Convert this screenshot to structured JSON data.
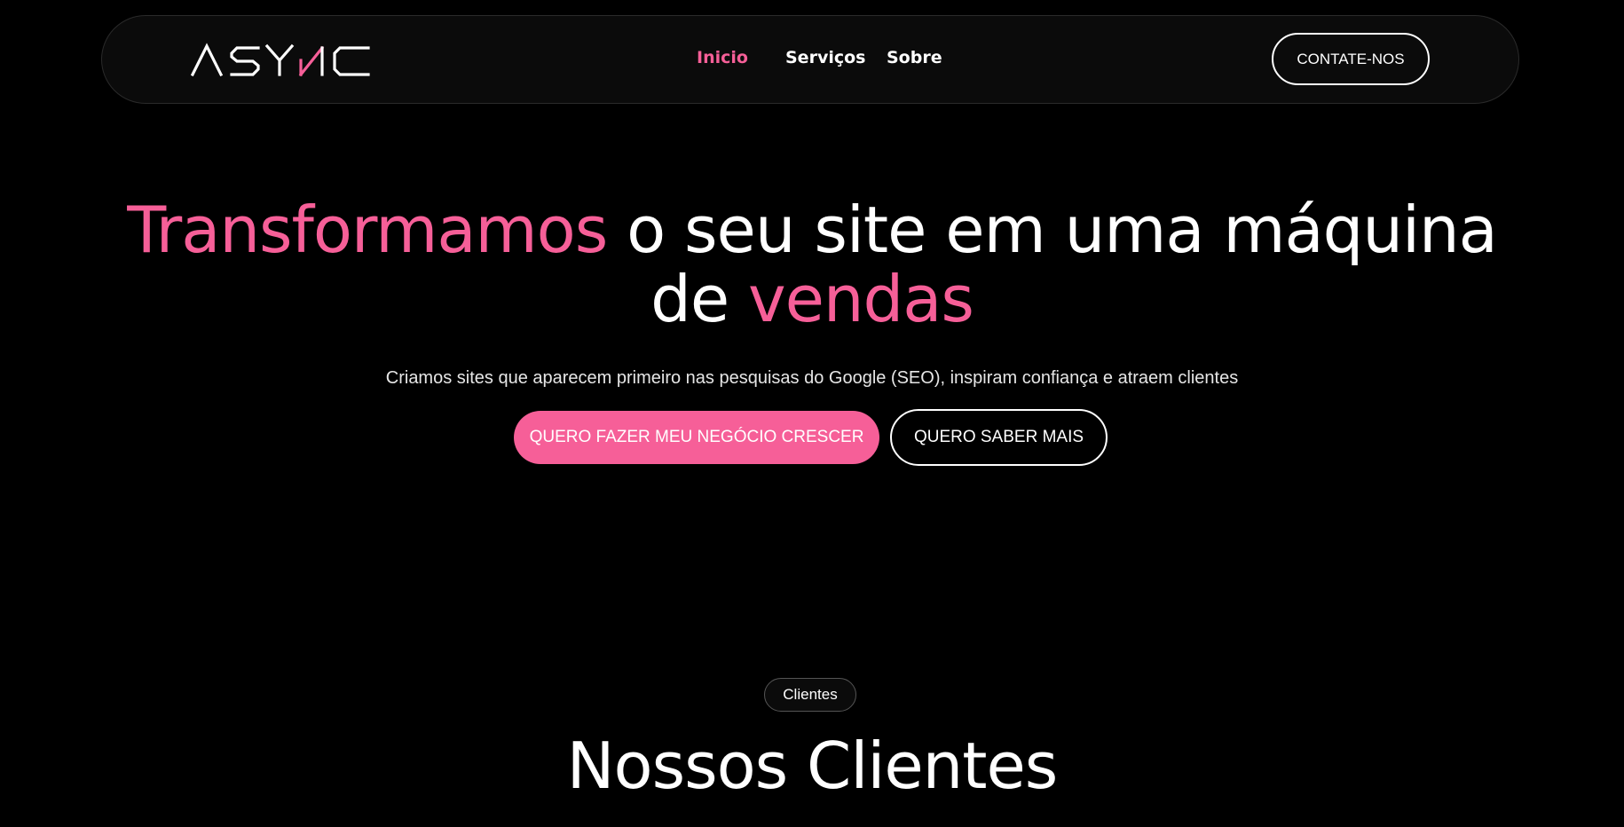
{
  "colors": {
    "background": "#000000",
    "accent": "#f65f98",
    "navbar_bg": "#0b0b0b",
    "text": "#ffffff"
  },
  "header": {
    "logo_text": "ASYNC",
    "nav": [
      {
        "label": "Inicio",
        "active": true
      },
      {
        "label": "Serviços",
        "active": false
      },
      {
        "label": "Sobre",
        "active": false
      }
    ],
    "contact_label": "CONTATE-NOS"
  },
  "hero": {
    "title_part1": "Transformamos",
    "title_part2": " o seu site em uma máquina",
    "title_part3": "de ",
    "title_part4": "vendas",
    "subtitle": "Criamos sites que aparecem primeiro nas pesquisas do Google (SEO), inspiram confiança e atraem clientes",
    "primary_cta": "QUERO FAZER MEU NEGÓCIO CRESCER",
    "secondary_cta": "QUERO SABER MAIS"
  },
  "clients_section": {
    "badge": "Clientes",
    "title": "Nossos Clientes"
  }
}
